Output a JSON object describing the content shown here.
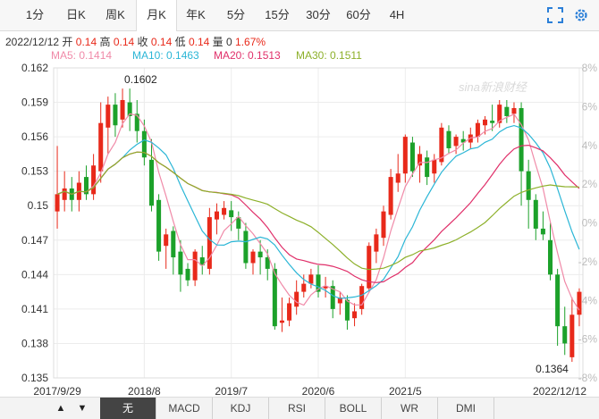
{
  "tabs": [
    {
      "label": "1分",
      "active": false
    },
    {
      "label": "日K",
      "active": false
    },
    {
      "label": "周K",
      "active": false
    },
    {
      "label": "月K",
      "active": true
    },
    {
      "label": "年K",
      "active": false
    },
    {
      "label": "5分",
      "active": false
    },
    {
      "label": "15分",
      "active": false
    },
    {
      "label": "30分",
      "active": false
    },
    {
      "label": "60分",
      "active": false
    },
    {
      "label": "4H",
      "active": false
    }
  ],
  "icons": {
    "fullscreen": "fullscreen-icon",
    "settings": "settings-icon"
  },
  "info": {
    "date": "2022/12/12",
    "open_label": "开",
    "open": "0.14",
    "high_label": "高",
    "high": "0.14",
    "close_label": "收",
    "close": "0.14",
    "low_label": "低",
    "low": "0.14",
    "vol_label": "量",
    "vol": "0",
    "change": "1.67%"
  },
  "ma": [
    {
      "label": "MA5: 0.1414",
      "color": "#f08aa8"
    },
    {
      "label": "MA10: 0.1463",
      "color": "#2bb6d6"
    },
    {
      "label": "MA20: 0.1513",
      "color": "#e0306a"
    },
    {
      "label": "MA30: 0.1511",
      "color": "#8db02a"
    }
  ],
  "watermark": "sina新浪财经",
  "colors": {
    "up": "#e8291a",
    "down": "#1ca12a",
    "grid": "#ececec",
    "axis": "#333",
    "pct": "#bbbbbb"
  },
  "chart_data": {
    "type": "candlestick",
    "y_ticks": [
      "0.162",
      "0.159",
      "0.156",
      "0.153",
      "0.15",
      "0.147",
      "0.144",
      "0.141",
      "0.138",
      "0.135"
    ],
    "ylim": [
      0.135,
      0.162
    ],
    "pct_ticks": [
      "8%",
      "6%",
      "4%",
      "2%",
      "0%",
      "-2%",
      "-4%",
      "-6%",
      "-8%"
    ],
    "x_ticks": [
      "2017/9/29",
      "2018/8",
      "2019/7",
      "2020/6",
      "2021/5",
      "2022/12/12"
    ],
    "annotations": [
      {
        "text": "0.1602",
        "type": "max"
      },
      {
        "text": "0.1364",
        "type": "min"
      }
    ],
    "candles": [
      [
        0.1495,
        0.151,
        0.1552,
        0.148
      ],
      [
        0.1505,
        0.1515,
        0.153,
        0.1495
      ],
      [
        0.1515,
        0.1505,
        0.1525,
        0.1495
      ],
      [
        0.1505,
        0.152,
        0.153,
        0.1495
      ],
      [
        0.1525,
        0.151,
        0.1535,
        0.1505
      ],
      [
        0.151,
        0.1535,
        0.1545,
        0.1505
      ],
      [
        0.153,
        0.1572,
        0.159,
        0.152
      ],
      [
        0.1568,
        0.1588,
        0.1595,
        0.1545
      ],
      [
        0.1588,
        0.157,
        0.1598,
        0.156
      ],
      [
        0.1575,
        0.1592,
        0.1602,
        0.1568
      ],
      [
        0.159,
        0.1578,
        0.1602,
        0.1565
      ],
      [
        0.158,
        0.1565,
        0.1592,
        0.1555
      ],
      [
        0.1565,
        0.1542,
        0.1575,
        0.1535
      ],
      [
        0.154,
        0.15,
        0.1558,
        0.1495
      ],
      [
        0.1505,
        0.146,
        0.151,
        0.1452
      ],
      [
        0.1465,
        0.1475,
        0.148,
        0.1445
      ],
      [
        0.1478,
        0.1455,
        0.1482,
        0.144
      ],
      [
        0.146,
        0.144,
        0.147,
        0.1425
      ],
      [
        0.1445,
        0.1435,
        0.145,
        0.143
      ],
      [
        0.1435,
        0.146,
        0.1462,
        0.143
      ],
      [
        0.1455,
        0.1448,
        0.1465,
        0.144
      ],
      [
        0.1445,
        0.149,
        0.1498,
        0.144
      ],
      [
        0.1488,
        0.1495,
        0.1502,
        0.1475
      ],
      [
        0.1492,
        0.1498,
        0.1504,
        0.1488
      ],
      [
        0.1496,
        0.149,
        0.1504,
        0.1478
      ],
      [
        0.149,
        0.148,
        0.1495,
        0.147
      ],
      [
        0.1478,
        0.145,
        0.1485,
        0.1445
      ],
      [
        0.145,
        0.146,
        0.1462,
        0.144
      ],
      [
        0.146,
        0.1455,
        0.147,
        0.144
      ],
      [
        0.1455,
        0.1445,
        0.1462,
        0.1435
      ],
      [
        0.1445,
        0.1395,
        0.145,
        0.1392
      ],
      [
        0.1398,
        0.14,
        0.142,
        0.139
      ],
      [
        0.14,
        0.1415,
        0.142,
        0.1395
      ],
      [
        0.1412,
        0.1425,
        0.1435,
        0.1405
      ],
      [
        0.1425,
        0.1432,
        0.144,
        0.142
      ],
      [
        0.1432,
        0.144,
        0.1445,
        0.1428
      ],
      [
        0.144,
        0.1425,
        0.1448,
        0.142
      ],
      [
        0.1428,
        0.143,
        0.1438,
        0.142
      ],
      [
        0.143,
        0.141,
        0.1435,
        0.1402
      ],
      [
        0.1415,
        0.142,
        0.1425,
        0.1405
      ],
      [
        0.1418,
        0.14,
        0.1422,
        0.1392
      ],
      [
        0.1402,
        0.1408,
        0.1415,
        0.1395
      ],
      [
        0.141,
        0.143,
        0.1432,
        0.1405
      ],
      [
        0.1428,
        0.1465,
        0.1468,
        0.1425
      ],
      [
        0.146,
        0.1475,
        0.148,
        0.145
      ],
      [
        0.1472,
        0.1495,
        0.15,
        0.1465
      ],
      [
        0.1492,
        0.1525,
        0.1532,
        0.1488
      ],
      [
        0.152,
        0.1528,
        0.1545,
        0.1512
      ],
      [
        0.1528,
        0.156,
        0.1562,
        0.152
      ],
      [
        0.1555,
        0.153,
        0.156,
        0.1525
      ],
      [
        0.1535,
        0.1545,
        0.1552,
        0.152
      ],
      [
        0.1542,
        0.1525,
        0.1548,
        0.1518
      ],
      [
        0.1528,
        0.154,
        0.1545,
        0.152
      ],
      [
        0.1538,
        0.1568,
        0.1572,
        0.1535
      ],
      [
        0.1565,
        0.155,
        0.157,
        0.1545
      ],
      [
        0.1552,
        0.156,
        0.1562,
        0.1545
      ],
      [
        0.1558,
        0.1555,
        0.1565,
        0.1548
      ],
      [
        0.1555,
        0.1562,
        0.1568,
        0.155
      ],
      [
        0.156,
        0.1572,
        0.1575,
        0.1555
      ],
      [
        0.157,
        0.1575,
        0.1578,
        0.1562
      ],
      [
        0.1574,
        0.1572,
        0.1588,
        0.1565
      ],
      [
        0.1572,
        0.1588,
        0.1592,
        0.1568
      ],
      [
        0.1586,
        0.1578,
        0.1592,
        0.1572
      ],
      [
        0.158,
        0.1585,
        0.159,
        0.1572
      ],
      [
        0.1585,
        0.153,
        0.159,
        0.15
      ],
      [
        0.153,
        0.1505,
        0.154,
        0.148
      ],
      [
        0.1505,
        0.148,
        0.151,
        0.147
      ],
      [
        0.148,
        0.1475,
        0.1495,
        0.147
      ],
      [
        0.147,
        0.144,
        0.1485,
        0.1435
      ],
      [
        0.144,
        0.1395,
        0.1445,
        0.1378
      ],
      [
        0.1395,
        0.138,
        0.1412,
        0.137
      ],
      [
        0.1368,
        0.1405,
        0.142,
        0.1364
      ],
      [
        0.1405,
        0.1425,
        0.1428,
        0.1395
      ]
    ]
  },
  "bottom": {
    "prev": "▲",
    "next": "▼",
    "indicators": [
      {
        "label": "无",
        "active": true
      },
      {
        "label": "MACD",
        "active": false
      },
      {
        "label": "KDJ",
        "active": false
      },
      {
        "label": "RSI",
        "active": false
      },
      {
        "label": "BOLL",
        "active": false
      },
      {
        "label": "WR",
        "active": false
      },
      {
        "label": "DMI",
        "active": false
      }
    ]
  }
}
